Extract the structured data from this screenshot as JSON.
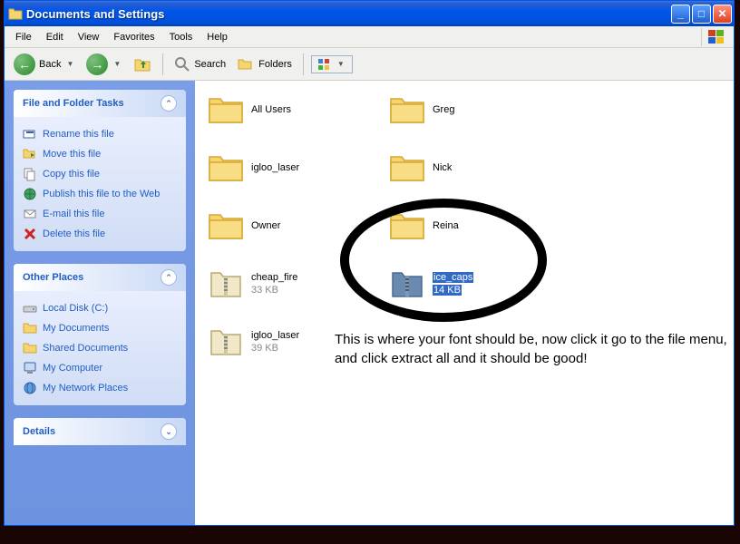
{
  "window": {
    "title": "Documents and Settings"
  },
  "menubar": [
    "File",
    "Edit",
    "View",
    "Favorites",
    "Tools",
    "Help"
  ],
  "toolbar": {
    "back": "Back",
    "search": "Search",
    "folders": "Folders"
  },
  "sidebar": {
    "tasks_title": "File and Folder Tasks",
    "tasks": [
      {
        "icon": "rename-icon",
        "label": "Rename this file"
      },
      {
        "icon": "move-icon",
        "label": "Move this file"
      },
      {
        "icon": "copy-icon",
        "label": "Copy this file"
      },
      {
        "icon": "publish-icon",
        "label": "Publish this file to the Web"
      },
      {
        "icon": "email-icon",
        "label": "E-mail this file"
      },
      {
        "icon": "delete-icon",
        "label": "Delete this file"
      }
    ],
    "places_title": "Other Places",
    "places": [
      {
        "icon": "disk-icon",
        "label": "Local Disk (C:)"
      },
      {
        "icon": "mydocs-icon",
        "label": "My Documents"
      },
      {
        "icon": "shared-icon",
        "label": "Shared Documents"
      },
      {
        "icon": "mycomputer-icon",
        "label": "My Computer"
      },
      {
        "icon": "network-icon",
        "label": "My Network Places"
      }
    ],
    "details_title": "Details"
  },
  "items": [
    {
      "type": "folder",
      "name": "All Users"
    },
    {
      "type": "folder",
      "name": "Greg"
    },
    {
      "type": "folder",
      "name": "igloo_laser"
    },
    {
      "type": "folder",
      "name": "Nick"
    },
    {
      "type": "folder",
      "name": "Owner"
    },
    {
      "type": "folder",
      "name": "Reina"
    },
    {
      "type": "zip",
      "name": "cheap_fire",
      "size": "33 KB"
    },
    {
      "type": "zip",
      "name": "ice_caps",
      "size": "14 KB",
      "selected": true
    },
    {
      "type": "zip",
      "name": "igloo_laser",
      "size": "39 KB"
    }
  ],
  "annotation": "This is where your font should be, now click it\ngo to the file menu, and click extract all and\nit should be good!"
}
